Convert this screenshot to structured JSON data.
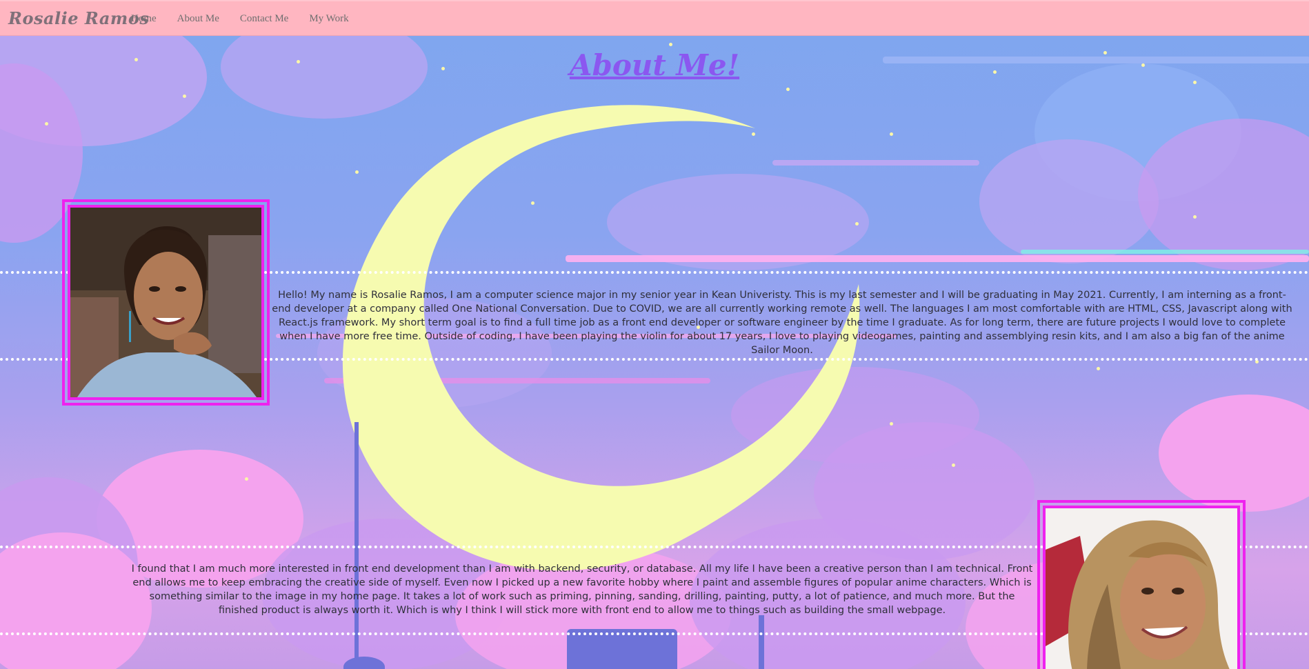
{
  "header": {
    "brand": "Rosalie Ramos",
    "nav": [
      "Home",
      "About Me",
      "Contact Me",
      "My Work"
    ]
  },
  "main": {
    "title": "About Me!",
    "paragraph1": "Hello! My name is Rosalie Ramos, I am a computer science major in my senior year in Kean Univeristy. This is my last semester and I will be graduating in May 2021. Currently, I am interning as a front-end developer at a company called One National Conversation. Due to COVID, we are all currently working remote as well. The languages I am most comfortable with are HTML, CSS, Javascript along with React.js framework. My short term goal is to find a full time job as a front end developer or software engineer by the time I graduate. As for long term, there are future projects I would love to complete when I have more free time. Outside of coding, I have been playing the violin for about 17 years, I love to playing videogames, painting and assemblying resin kits, and I am also a big fan of the anime Sailor Moon.",
    "paragraph2": "I found that I am much more interested in front end development than I am with backend, security, or database. All my life I have been a creative person than I am technical. Front end allows me to keep embracing the creative side of myself. Even now I picked up a new favorite hobby where I paint and assemble figures of popular anime characters. Which is something similar to the image in my home page. It takes a lot of work such as priming, pinning, sanding, drilling, painting, putty, a lot of patience, and much more. But the finished product is always worth it. Which is why I think I will stick more with front end to allow me to things such as building the small webpage."
  },
  "colors": {
    "header_bg": "#ffb6c1",
    "title": "#8b57f0",
    "frame": "#ee22ee",
    "moon": "#f6fbb0"
  },
  "icons": {
    "background": "sailor-moon-crescent-night-sky",
    "photo1": "profile-photo-1",
    "photo2": "profile-photo-2"
  }
}
